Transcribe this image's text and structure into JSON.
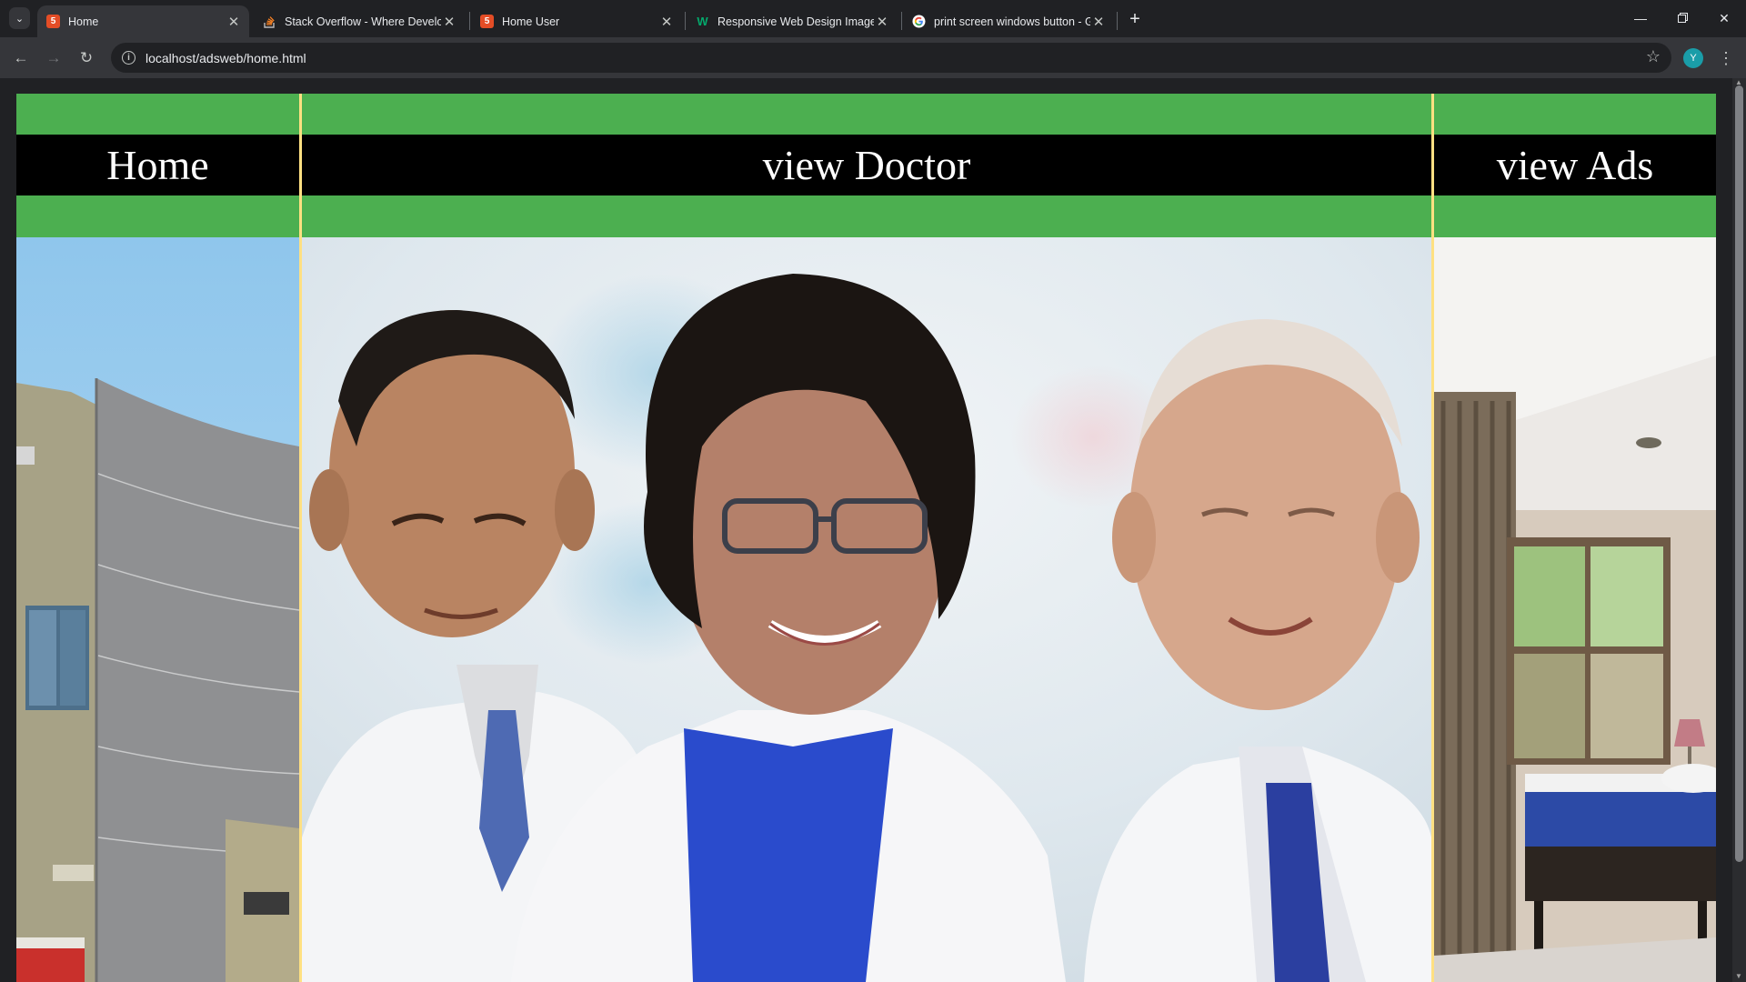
{
  "browser": {
    "tabs": [
      {
        "title": "Home",
        "favicon": "html5-icon",
        "active": true
      },
      {
        "title": "Stack Overflow - Where Develo",
        "favicon": "stackoverflow-icon",
        "active": false
      },
      {
        "title": "Home User",
        "favicon": "html5-icon",
        "active": false
      },
      {
        "title": "Responsive Web Design Images",
        "favicon": "w3schools-icon",
        "active": false
      },
      {
        "title": "print screen windows button - G",
        "favicon": "google-icon",
        "active": false
      }
    ],
    "url": "localhost/adsweb/home.html",
    "profile_initial": "Y"
  },
  "nav": {
    "home": "Home",
    "view_doctor": "view Doctor",
    "view_ads": "view Ads"
  },
  "colors": {
    "nav_green": "#4caf50",
    "nav_band": "#000000",
    "divider": "#ffe082",
    "browser_dark": "#202124"
  }
}
